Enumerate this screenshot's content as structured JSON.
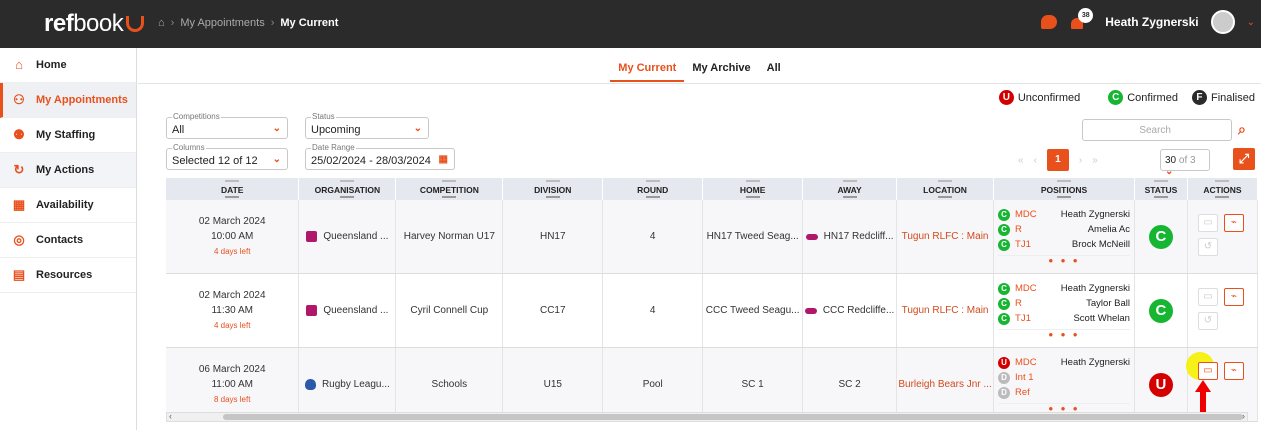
{
  "app": {
    "logo_bold": "ref",
    "logo_thin": "book"
  },
  "breadcrumb": {
    "section": "My Appointments",
    "current": "My Current"
  },
  "topbar": {
    "notification_count": "38",
    "user_name": "Heath Zygnerski"
  },
  "sidebar": {
    "items": [
      {
        "label": "Home",
        "icon": "home-icon",
        "glyph": "⌂"
      },
      {
        "label": "My Appointments",
        "icon": "appointments-icon",
        "glyph": "⚇"
      },
      {
        "label": "My Staffing",
        "icon": "staffing-icon",
        "glyph": "⚉"
      },
      {
        "label": "My Actions",
        "icon": "actions-icon",
        "glyph": "↻"
      },
      {
        "label": "Availability",
        "icon": "calendar-icon",
        "glyph": "▦"
      },
      {
        "label": "Contacts",
        "icon": "contacts-icon",
        "glyph": "◎"
      },
      {
        "label": "Resources",
        "icon": "resources-icon",
        "glyph": "▤"
      }
    ]
  },
  "tabs": [
    "My Current",
    "My Archive",
    "All"
  ],
  "legend": [
    {
      "letter": "U",
      "label": "Unconfirmed",
      "color": "#d40000"
    },
    {
      "letter": "C",
      "label": "Confirmed",
      "color": "#16b532"
    },
    {
      "letter": "F",
      "label": "Finalised",
      "color": "#2b2b2b"
    }
  ],
  "filters": {
    "competitions": {
      "label": "Competitions",
      "value": "All"
    },
    "status": {
      "label": "Status",
      "value": "Upcoming"
    },
    "columns": {
      "label": "Columns",
      "value": "Selected 12 of 12"
    },
    "date_range": {
      "label": "Date Range",
      "value": "25/02/2024 - 28/03/2024"
    }
  },
  "search": {
    "placeholder": "Search"
  },
  "pager": {
    "current_page": "1",
    "per_page": "30",
    "per_page_suffix": "of 3"
  },
  "table": {
    "headers": [
      "DATE",
      "ORGANISATION",
      "COMPETITION",
      "DIVISION",
      "ROUND",
      "HOME",
      "AWAY",
      "LOCATION",
      "POSITIONS",
      "STATUS",
      "ACTIONS"
    ],
    "rows": [
      {
        "date": "02 March 2024",
        "time": "10:00 AM",
        "left": "4 days left",
        "organisation": "Queensland ...",
        "competition": "Harvey Norman U17",
        "division": "HN17",
        "round": "4",
        "home": "HN17 Tweed Seag...",
        "away": "HN17 Redcliff...",
        "location": "Tugun RLFC : Main",
        "positions": [
          {
            "s": "C",
            "role": "MDC",
            "name": "Heath Zygnerski"
          },
          {
            "s": "C",
            "role": "R",
            "name": "Amelia Ac"
          },
          {
            "s": "C",
            "role": "TJ1",
            "name": "Brock McNeill"
          }
        ],
        "more": "• • •",
        "status": "C"
      },
      {
        "date": "02 March 2024",
        "time": "11:30 AM",
        "left": "4 days left",
        "organisation": "Queensland ...",
        "competition": "Cyril Connell Cup",
        "division": "CC17",
        "round": "4",
        "home": "CCC Tweed Seagu...",
        "away": "CCC Redcliffe...",
        "location": "Tugun RLFC : Main",
        "positions": [
          {
            "s": "C",
            "role": "MDC",
            "name": "Heath Zygnerski"
          },
          {
            "s": "C",
            "role": "R",
            "name": "Taylor Ball"
          },
          {
            "s": "C",
            "role": "TJ1",
            "name": "Scott Whelan"
          }
        ],
        "more": "• • •",
        "status": "C"
      },
      {
        "date": "06 March 2024",
        "time": "11:00 AM",
        "left": "8 days left",
        "organisation": "Rugby Leagu...",
        "competition": "Schools",
        "division": "U15",
        "round": "Pool",
        "home": "SC 1",
        "away": "SC 2",
        "location": "Burleigh Bears Jnr ...",
        "positions": [
          {
            "s": "U",
            "role": "MDC",
            "name": "Heath Zygnerski"
          },
          {
            "s": "D",
            "role": "Int 1",
            "name": ""
          },
          {
            "s": "D",
            "role": "Ref",
            "name": ""
          }
        ],
        "more": "• • •",
        "status": "U"
      }
    ]
  }
}
